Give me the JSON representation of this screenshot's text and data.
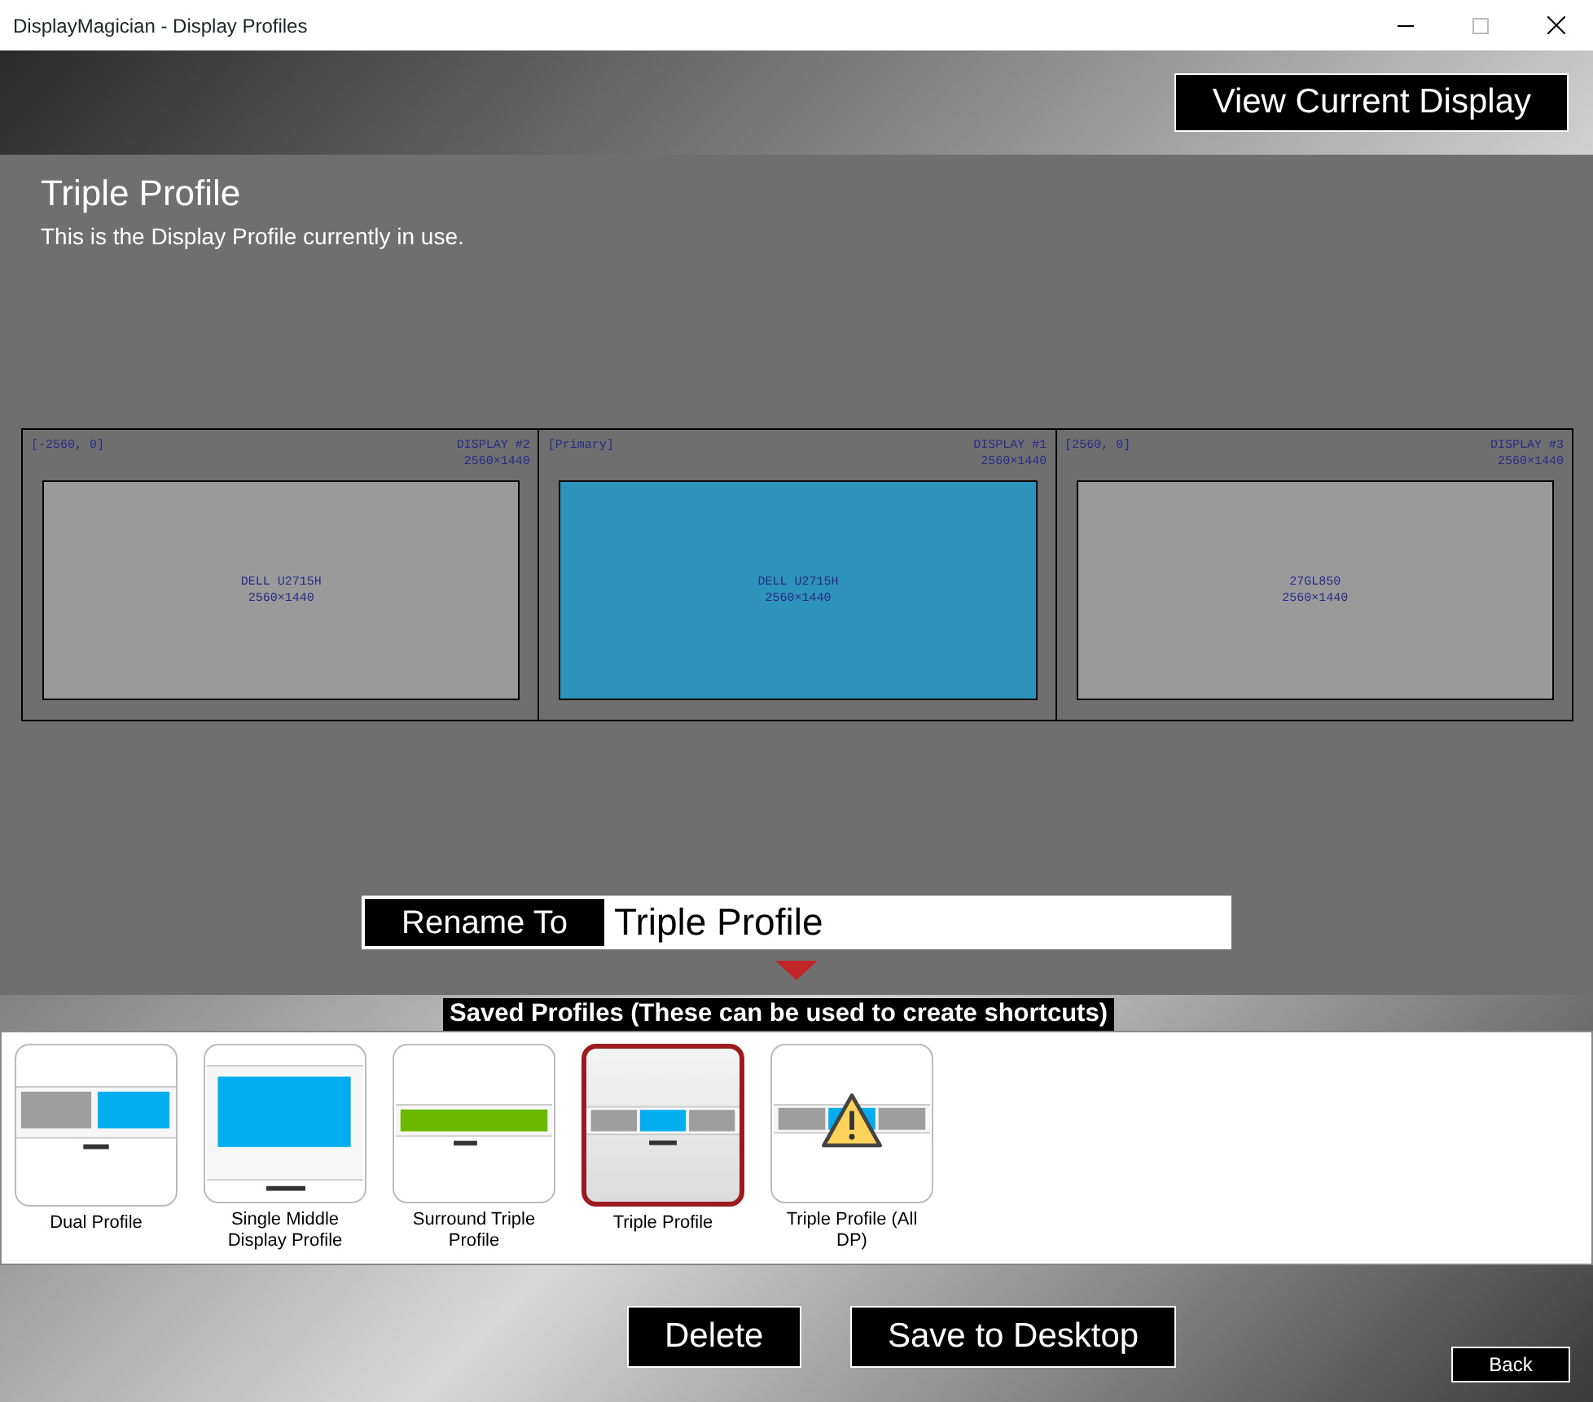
{
  "window": {
    "title": "DisplayMagician - Display Profiles"
  },
  "view_current_button": "View Current Display",
  "current_profile": {
    "name": "Triple Profile",
    "description": "This is the Display Profile currently in use."
  },
  "displays": [
    {
      "position": "[-2560, 0]",
      "display": "DISPLAY #2",
      "resolution": "2560×1440",
      "model": "DELL U2715H",
      "model_resolution": "2560×1440",
      "selected": false
    },
    {
      "position": "[Primary]",
      "display": "DISPLAY #1",
      "resolution": "2560×1440",
      "model": "DELL U2715H",
      "model_resolution": "2560×1440",
      "selected": true
    },
    {
      "position": "[2560, 0]",
      "display": "DISPLAY #3",
      "resolution": "2560×1440",
      "model": "27GL850",
      "model_resolution": "2560×1440",
      "selected": false
    }
  ],
  "rename": {
    "label": "Rename To",
    "value": "Triple Profile"
  },
  "saved_profiles_label": "Saved Profiles (These can be used to create shortcuts)",
  "profiles": [
    {
      "name": "Dual Profile",
      "kind": "dual",
      "warning": false,
      "selected": false
    },
    {
      "name": "Single Middle Display Profile",
      "kind": "single",
      "warning": false,
      "selected": false
    },
    {
      "name": "Surround Triple Profile",
      "kind": "surround",
      "warning": false,
      "selected": false
    },
    {
      "name": "Triple Profile",
      "kind": "triple",
      "warning": false,
      "selected": true
    },
    {
      "name": "Triple Profile (All DP)",
      "kind": "triple",
      "warning": true,
      "selected": false
    }
  ],
  "buttons": [
    "Delete",
    "Save to Desktop"
  ],
  "back_button": "Back"
}
